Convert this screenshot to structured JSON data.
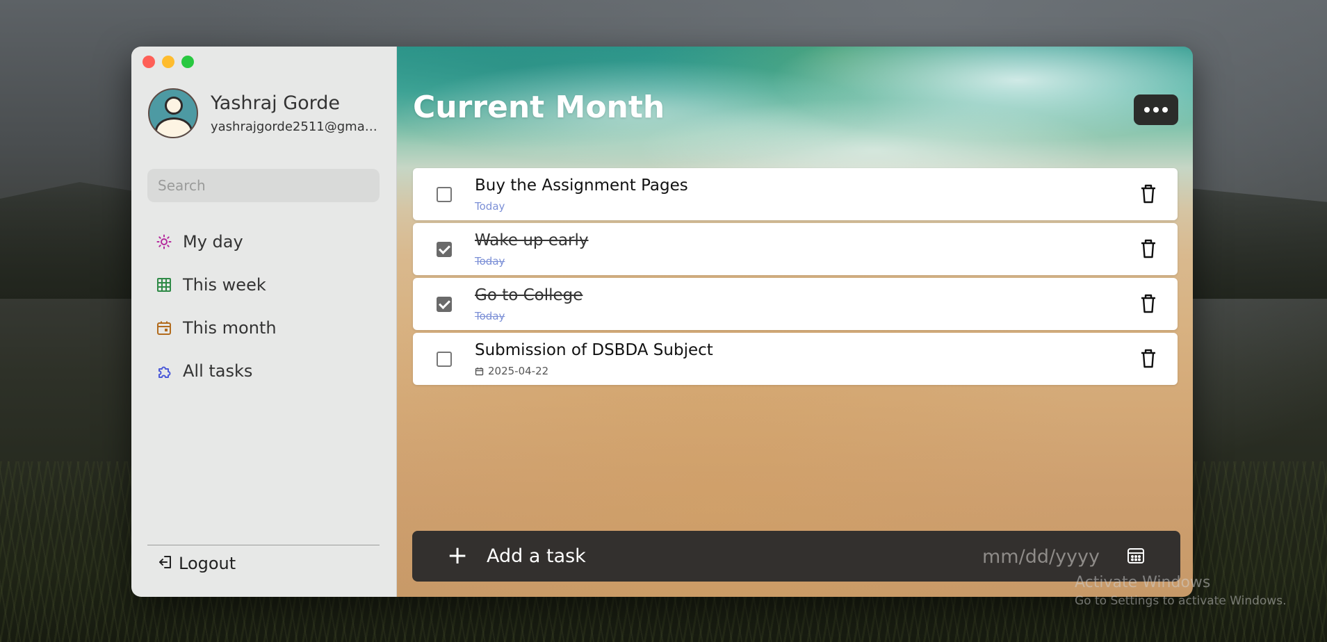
{
  "profile": {
    "name": "Yashraj Gorde",
    "email": "yashrajgorde2511@gmail...."
  },
  "search": {
    "placeholder": "Search"
  },
  "sidebar": {
    "items": [
      {
        "label": "My day",
        "icon": "sun-icon",
        "color": "#b4289c"
      },
      {
        "label": "This week",
        "icon": "grid-icon",
        "color": "#2f8a47"
      },
      {
        "label": "This month",
        "icon": "calendar-icon",
        "color": "#b26b1d"
      },
      {
        "label": "All tasks",
        "icon": "puzzle-icon",
        "color": "#4c5ad8"
      }
    ],
    "logout_label": "Logout"
  },
  "main": {
    "title": "Current Month",
    "more_icon": "more-icon"
  },
  "tasks": [
    {
      "title": "Buy the Assignment Pages",
      "subtitle": "Today",
      "completed": false
    },
    {
      "title": "Wake up early",
      "subtitle": "Today",
      "completed": true
    },
    {
      "title": "Go to College",
      "subtitle": "Today",
      "completed": true
    },
    {
      "title": "Submission of DSBDA Subject",
      "subtitle": "2025-04-22",
      "completed": false
    }
  ],
  "add_task": {
    "plus": "+",
    "label": "Add a task",
    "date_placeholder": "mm/dd/yyyy"
  },
  "watermark": {
    "title": "Activate Windows",
    "subtitle": "Go to Settings to activate Windows."
  },
  "colors": {
    "close": "#fe5f57",
    "minimize": "#febc2e",
    "maximize": "#28c840",
    "due_today": "#7b8fd6",
    "add_bar": "#33302e"
  }
}
